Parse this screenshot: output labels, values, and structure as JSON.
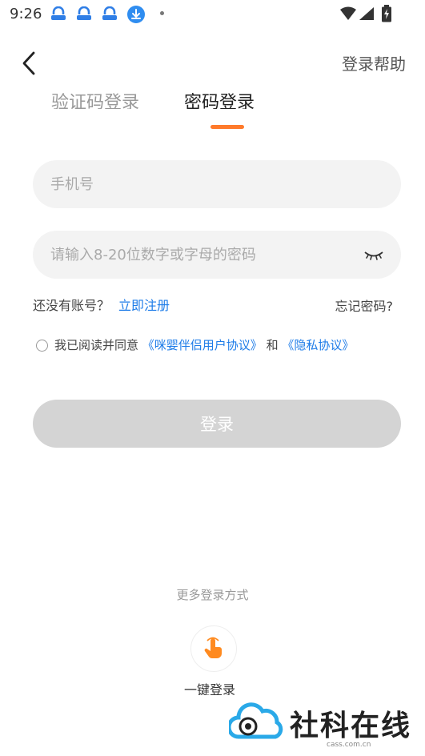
{
  "status_bar": {
    "time": "9:26"
  },
  "header": {
    "help_label": "登录帮助"
  },
  "tabs": [
    {
      "label": "验证码登录",
      "active": false
    },
    {
      "label": "密码登录",
      "active": true
    }
  ],
  "form": {
    "phone_placeholder": "手机号",
    "password_placeholder": "请输入8-20位数字或字母的密码",
    "no_account_text": "还没有账号？",
    "register_link": "立即注册",
    "forgot_link": "忘记密码?"
  },
  "agreement": {
    "prefix": "我已阅读并同意",
    "user_agreement": "《咪婴伴侣用户协议》",
    "and": "和",
    "privacy_policy": "《隐私协议》"
  },
  "login_button": {
    "label": "登录"
  },
  "more_login": {
    "title": "更多登录方式",
    "onekey_label": "一键登录"
  },
  "watermark": {
    "name": "社科在线",
    "domain": "cass.com.cn"
  },
  "colors": {
    "accent": "#ff7a2b",
    "link": "#1e7ce8",
    "disabled_button": "#d4d4d4",
    "field_bg": "#f3f3f3"
  },
  "icons": [
    "back-arrow-icon",
    "eye-closed-icon",
    "one-tap-hand-icon",
    "download-icon",
    "wifi-icon",
    "signal-icon",
    "battery-icon"
  ]
}
